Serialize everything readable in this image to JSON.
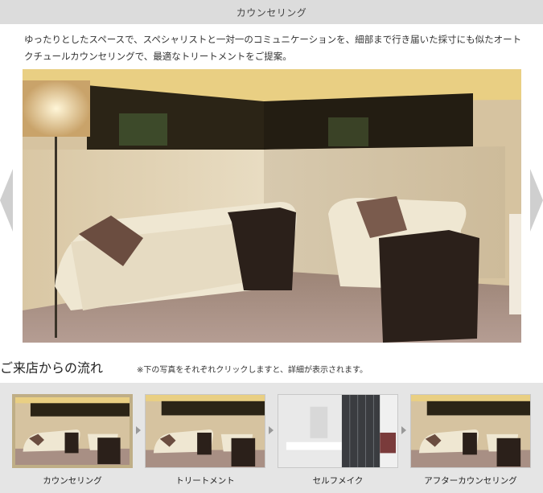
{
  "header": {
    "title": "カウンセリング"
  },
  "intro": {
    "text": "ゆったりとしたスペースで、スペシャリストと一対一のコミュニケーションを、細部まで行き届いた採寸にも似たオートクチュールカウンセリングで、最適なトリートメントをご提案。"
  },
  "slider": {
    "image_icon": "counseling-room-photo",
    "prev_icon": "chevron-left-icon",
    "next_icon": "chevron-right-icon"
  },
  "flow": {
    "title": "ご来店からの流れ",
    "note": "※下の写真をそれぞれクリックしますと、詳細が表示されます。",
    "steps": [
      {
        "label": "カウンセリング",
        "active": true
      },
      {
        "label": "トリートメント",
        "active": false
      },
      {
        "label": "セルフメイク",
        "active": false
      },
      {
        "label": "アフターカウンセリング",
        "active": false
      }
    ]
  },
  "colors": {
    "header_bg": "#dcdcdc",
    "strip_bg": "#e5e5e5",
    "active_border": "#bfae86",
    "arrow": "#cfcfcf"
  }
}
